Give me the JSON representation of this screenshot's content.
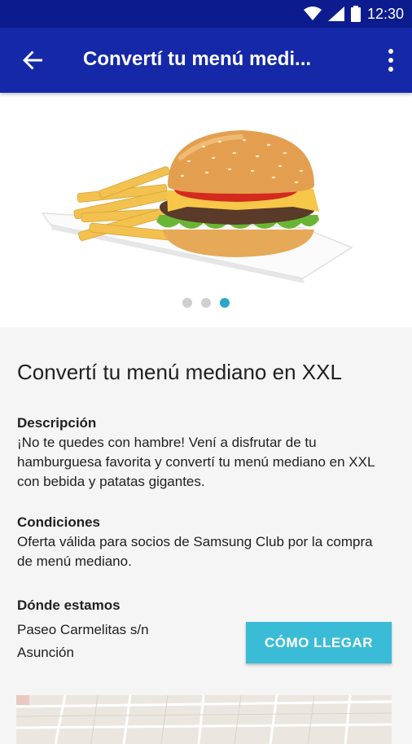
{
  "status_bar": {
    "time": "12:30",
    "icons": [
      "wifi-icon",
      "signal-icon",
      "battery-icon"
    ]
  },
  "app_bar": {
    "title": "Convertí tu menú medi...",
    "back_icon": "arrow-left-icon",
    "more_icon": "more-vert-icon"
  },
  "carousel": {
    "slides": 3,
    "active_index": 2
  },
  "offer": {
    "title": "Convertí tu menú mediano en XXL",
    "description": {
      "heading": "Descripción",
      "text": "¡No te quedes con hambre! Vení a disfrutar de tu hamburguesa favorita y convertí tu menú mediano en XXL con bebida y patatas gigantes."
    },
    "conditions": {
      "heading": "Condiciones",
      "text": "Oferta válida para socios de Samsung Club por la compra de menú mediano."
    },
    "location": {
      "heading": "Dónde estamos",
      "address_line1": "Paseo Carmelitas s/n",
      "address_line2": "Asunción",
      "button_label": "CÓMO LLEGAR"
    }
  },
  "colors": {
    "status_bar": "#0c1c8e",
    "app_bar": "#1428a8",
    "accent": "#3bbcd6",
    "dot_active": "#2aa7c6"
  }
}
